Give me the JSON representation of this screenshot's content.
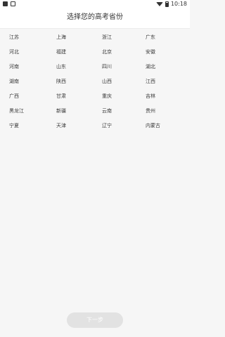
{
  "status_bar": {
    "time": "10:18"
  },
  "header": {
    "title": "选择您的高考省份"
  },
  "provinces": [
    [
      "江苏",
      "上海",
      "浙江",
      "广东"
    ],
    [
      "河北",
      "福建",
      "北京",
      "安徽"
    ],
    [
      "河南",
      "山东",
      "四川",
      "湖北"
    ],
    [
      "湖南",
      "陕西",
      "山西",
      "江西"
    ],
    [
      "广西",
      "甘肃",
      "重庆",
      "吉林"
    ],
    [
      "黑龙江",
      "新疆",
      "云南",
      "贵州"
    ],
    [
      "宁夏",
      "天津",
      "辽宁",
      "内蒙古"
    ]
  ],
  "footer": {
    "next_label": "下一步"
  },
  "colors": {
    "background": "#f6f6f6",
    "button_disabled": "#e2e2e2"
  }
}
